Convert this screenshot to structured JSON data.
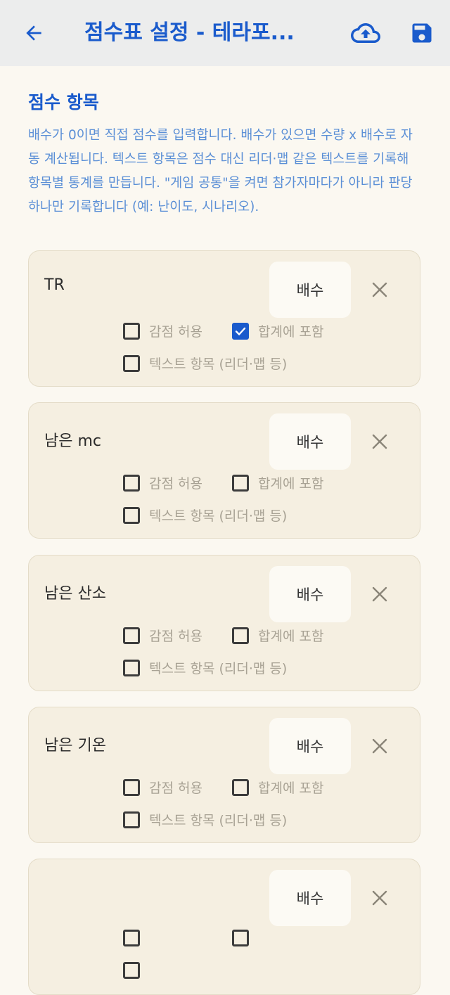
{
  "appbar": {
    "title": "점수표 설정 - 테라포...",
    "back_icon": "arrow-left-icon",
    "upload_icon": "cloud-upload-icon",
    "save_icon": "floppy-disk-icon",
    "accent_color": "#1a5bcc"
  },
  "section": {
    "title": "점수 항목",
    "help": "배수가 0이면 직접 점수를 입력합니다. 배수가 있으면 수량 x 배수로 자동 계산됩니다. 텍스트 항목은 점수 대신 리더·맵 같은 텍스트를 기록해 항목별 통계를 만듭니다. \"게임 공통\"을 켜면 참가자마다가 아니라 판당 하나만 기록합니다 (예: 난이도, 시나리오)."
  },
  "items": [
    {
      "name": "TR",
      "multiplier_placeholder": "배수",
      "allow_negative": {
        "label": "감점 허용",
        "checked": false
      },
      "include_in_total": {
        "label": "합계에 포함",
        "checked": true
      },
      "text_item": {
        "label": "텍스트 항목 (리더·맵 등)",
        "checked": false
      }
    },
    {
      "name": "남은 mc",
      "multiplier_placeholder": "배수",
      "allow_negative": {
        "label": "감점 허용",
        "checked": false
      },
      "include_in_total": {
        "label": "합계에 포함",
        "checked": false
      },
      "text_item": {
        "label": "텍스트 항목 (리더·맵 등)",
        "checked": false
      }
    },
    {
      "name": "남은 산소",
      "multiplier_placeholder": "배수",
      "allow_negative": {
        "label": "감점 허용",
        "checked": false
      },
      "include_in_total": {
        "label": "합계에 포함",
        "checked": false
      },
      "text_item": {
        "label": "텍스트 항목 (리더·맵 등)",
        "checked": false
      }
    },
    {
      "name": "남은 기온",
      "multiplier_placeholder": "배수",
      "allow_negative": {
        "label": "감점 허용",
        "checked": false
      },
      "include_in_total": {
        "label": "합계에 포함",
        "checked": false
      },
      "text_item": {
        "label": "텍스트 항목 (리더·맵 등)",
        "checked": false
      }
    },
    {
      "name": "",
      "multiplier_placeholder": "배수",
      "allow_negative": {
        "label": "",
        "checked": false
      },
      "include_in_total": {
        "label": "",
        "checked": false
      },
      "text_item": {
        "label": "",
        "checked": false
      }
    }
  ]
}
